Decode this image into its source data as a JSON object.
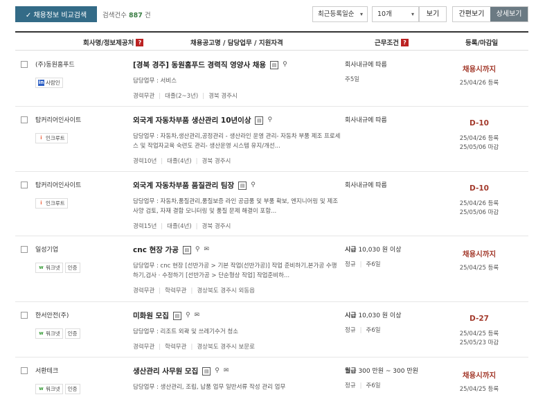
{
  "toolbar": {
    "compare_label": "✓ 채용정보 비교검색",
    "count_prefix": "검색건수",
    "count_value": "887",
    "count_suffix": "건",
    "sort_value": "최근등록일순",
    "size_value": "10개",
    "view_label": "보기",
    "simple_view": "간편보기",
    "detail_view": "상세보기"
  },
  "header": {
    "company": "회사명/정보제공처",
    "job": "채용공고명 / 담당업무 / 지원자격",
    "condition": "근무조건",
    "date": "등록/마감일",
    "help": "?"
  },
  "rows": [
    {
      "company": "(주)동원홈푸드",
      "badges": [
        {
          "type": "saramin",
          "logo": "in",
          "label": "사람인"
        }
      ],
      "title": "[경북 경주] 동원홈푸드 경력직 영양사 채용",
      "duty": "담당업무 : 서비스",
      "meta": [
        "경력무관",
        "대졸(2~3년)",
        "경북 경주시"
      ],
      "cond1": "회사내규에 따름",
      "cond2": [
        "주5일"
      ],
      "deadline": "채용시까지",
      "dates": [
        "25/04/26 등록"
      ]
    },
    {
      "company": "탑커리어인사이트",
      "badges": [
        {
          "type": "incruit",
          "logo": "i",
          "label": "인크루트"
        }
      ],
      "title": "외국계 자동차부품 생산관리 10년이상",
      "duty": "담당업무 : 자동차,생산관리,공정관리 - 생산라인 운영 관리- 자동차 부품 제조 프로세스 및 작업자교육 숙련도 관리- 생산운영 시스템 유지/개선...",
      "meta": [
        "경력10년",
        "대졸(4년)",
        "경북 경주시"
      ],
      "cond1": "회사내규에 따름",
      "cond2": [],
      "deadline": "D-10",
      "dates": [
        "25/04/26 등록",
        "25/05/06 마감"
      ]
    },
    {
      "company": "탑커리어인사이트",
      "badges": [
        {
          "type": "incruit",
          "logo": "i",
          "label": "인크루트"
        }
      ],
      "title": "외국계 자동차부품 품질관리 팀장",
      "duty": "담당업무 : 자동차,품질관리,품질보증 라인 공급품 및 부품 확보, 엔지니어링 및 제조 사양 검토, 자재 결함 모니터링 및 품질 문제 해결이 포함...",
      "meta": [
        "경력15년",
        "대졸(4년)",
        "경북 경주시"
      ],
      "cond1": "회사내규에 따름",
      "cond2": [],
      "deadline": "D-10",
      "dates": [
        "25/04/26 등록",
        "25/05/06 마감"
      ]
    },
    {
      "company": "일성기업",
      "badges": [
        {
          "type": "work",
          "logo": "w",
          "label": "워크넷"
        },
        {
          "type": "cert",
          "logo": "",
          "label": "인증"
        }
      ],
      "title": "cnc 현장 가공",
      "duty": "담당업무 : cnc 현장 [선반가공 > 기본 작업(선반가공)] 작업 준비하기,본가공 수행하기,검사 · 수정하기 [선반가공 > 단순형상 작업] 작업준비하...",
      "meta": [
        "경력무관",
        "학력무관",
        "경상북도 경주시 외동읍"
      ],
      "cond1_label": "시급",
      "cond1": "10,030 원 이상",
      "cond2": [
        "정규",
        "주6일"
      ],
      "deadline": "채용시까지",
      "dates": [
        "25/04/25 등록"
      ]
    },
    {
      "company": "한서안전(주)",
      "badges": [
        {
          "type": "work",
          "logo": "w",
          "label": "워크넷"
        },
        {
          "type": "cert",
          "logo": "",
          "label": "인증"
        }
      ],
      "title": "미화원 모집",
      "duty": "담당업무 : 리조트 외곽 및 쓰레기수거 청소",
      "meta": [
        "경력무관",
        "학력무관",
        "경상북도 경주시 보문로"
      ],
      "cond1_label": "시급",
      "cond1": "10,030 원 이상",
      "cond2": [
        "정규",
        "주6일"
      ],
      "deadline": "D-27",
      "dates": [
        "25/04/25 등록",
        "25/05/23 마감"
      ]
    },
    {
      "company": "서환테크",
      "badges": [
        {
          "type": "work",
          "logo": "w",
          "label": "워크넷"
        },
        {
          "type": "cert",
          "logo": "",
          "label": "인증"
        }
      ],
      "title": "생산관리 사무원 모집",
      "duty": "담당업무 : 생산관리, 조립, 납품 업무 일반서류 작성 관리 업무",
      "meta": [],
      "cond1_label": "월급",
      "cond1": "300 만원 ~ 300 만원",
      "cond2": [
        "정규",
        "주6일"
      ],
      "deadline": "채용시까지",
      "dates": [
        "25/04/25 등록"
      ]
    }
  ]
}
